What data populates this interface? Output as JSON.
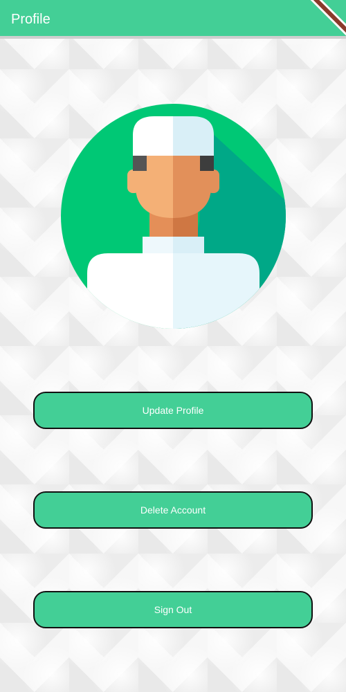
{
  "appbar": {
    "title": "Profile"
  },
  "avatar": {
    "icon": "user-avatar-icon",
    "colors": {
      "background_light": "#00c875",
      "background_shadow": "#00a887",
      "skin_light": "#f4b076",
      "skin_dark": "#e2905a",
      "cap_light": "#ffffff",
      "cap_dark": "#d9eff7",
      "clothes_light": "#ffffff",
      "clothes_dark": "#e6f6fb"
    }
  },
  "actions": {
    "update_profile": "Update Profile",
    "delete_account": "Delete Account",
    "sign_out": "Sign Out"
  },
  "theme": {
    "primary": "#43cf96",
    "button_border": "#111111",
    "button_text": "#ffffff"
  }
}
